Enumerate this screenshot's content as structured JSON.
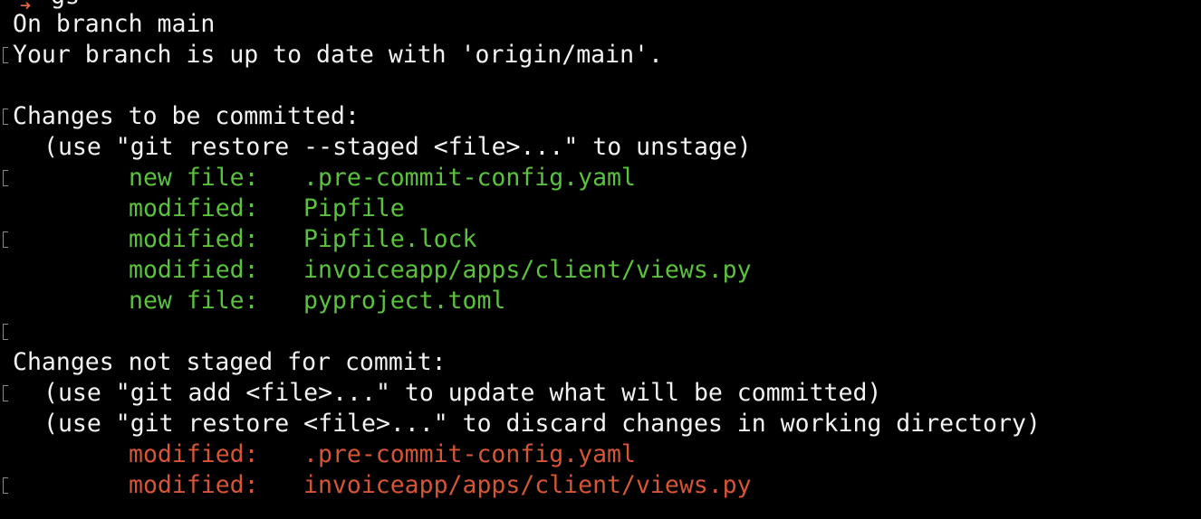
{
  "prompt": {
    "command": "gs"
  },
  "status": {
    "branch_line": "On branch main",
    "upstream_line": "Your branch is up to date with 'origin/main'.",
    "staged": {
      "header": "Changes to be committed:",
      "hint": "(use \"git restore --staged <file>...\" to unstage)",
      "entries": [
        {
          "label": "new file:",
          "path": ".pre-commit-config.yaml"
        },
        {
          "label": "modified:",
          "path": "Pipfile"
        },
        {
          "label": "modified:",
          "path": "Pipfile.lock"
        },
        {
          "label": "modified:",
          "path": "invoiceapp/apps/client/views.py"
        },
        {
          "label": "new file:",
          "path": "pyproject.toml"
        }
      ]
    },
    "unstaged": {
      "header": "Changes not staged for commit:",
      "hints": [
        "(use \"git add <file>...\" to update what will be committed)",
        "(use \"git restore <file>...\" to discard changes in working directory)"
      ],
      "entries": [
        {
          "label": "modified:",
          "path": ".pre-commit-config.yaml"
        },
        {
          "label": "modified:",
          "path": "invoiceapp/apps/client/views.py"
        }
      ]
    }
  },
  "colors": {
    "background": "#000000",
    "text": "#f2f2f2",
    "staged": "#5ac23c",
    "unstaged": "#d55535",
    "prompt_icon": "#e8623a"
  },
  "icons": {
    "prompt": "prompt-arrow-icon"
  }
}
